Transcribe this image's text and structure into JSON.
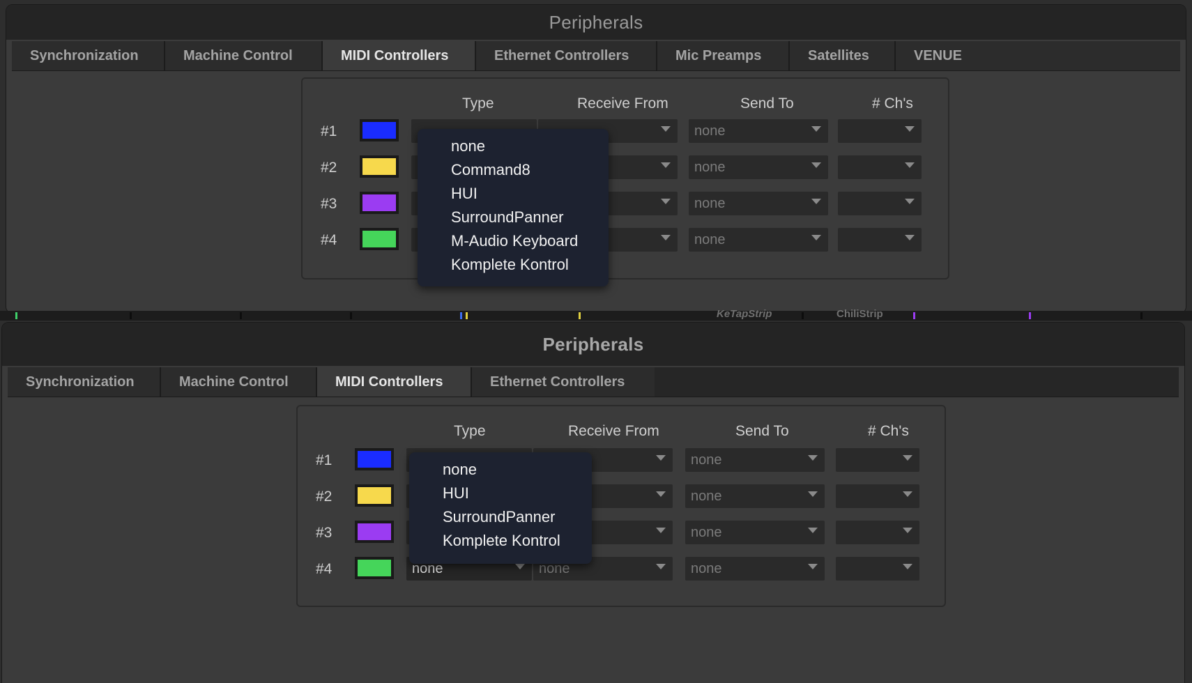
{
  "window1": {
    "title": "Peripherals",
    "tabs": [
      {
        "label": "Synchronization"
      },
      {
        "label": "Machine Control"
      },
      {
        "label": "MIDI Controllers",
        "active": true
      },
      {
        "label": "Ethernet Controllers"
      },
      {
        "label": "Mic Preamps"
      },
      {
        "label": "Satellites"
      },
      {
        "label": "VENUE"
      }
    ],
    "columns": {
      "type": "Type",
      "receive": "Receive From",
      "send": "Send To",
      "chs": "# Ch's"
    },
    "rows": [
      {
        "label": "#1",
        "color": "#1a2cff",
        "send": "none"
      },
      {
        "label": "#2",
        "color": "#f7d94c",
        "send": "none"
      },
      {
        "label": "#3",
        "color": "#9b3cf2",
        "send": "none"
      },
      {
        "label": "#4",
        "color": "#45d55a",
        "send": "none"
      }
    ],
    "type_dropdown_options": [
      "none",
      "Command8",
      "HUI",
      "SurroundPanner",
      "M-Audio Keyboard",
      "Komplete Kontrol"
    ]
  },
  "strip": {
    "label_a": "KeTapStrip",
    "label_b": "ChiliStrip"
  },
  "window2": {
    "title": "Peripherals",
    "tabs": [
      {
        "label": "Synchronization"
      },
      {
        "label": "Machine Control"
      },
      {
        "label": "MIDI Controllers",
        "active": true
      },
      {
        "label": "Ethernet Controllers"
      }
    ],
    "columns": {
      "type": "Type",
      "receive": "Receive From",
      "send": "Send To",
      "chs": "# Ch's"
    },
    "rows": [
      {
        "label": "#1",
        "color": "#1a2cff",
        "send": "none"
      },
      {
        "label": "#2",
        "color": "#f7d94c",
        "send": "none"
      },
      {
        "label": "#3",
        "color": "#9b3cf2",
        "send": "none"
      },
      {
        "label": "#4",
        "color": "#45d55a",
        "type": "none",
        "receive": "none",
        "send": "none"
      }
    ],
    "type_dropdown_options": [
      "none",
      "HUI",
      "SurroundPanner",
      "Komplete Kontrol"
    ]
  }
}
